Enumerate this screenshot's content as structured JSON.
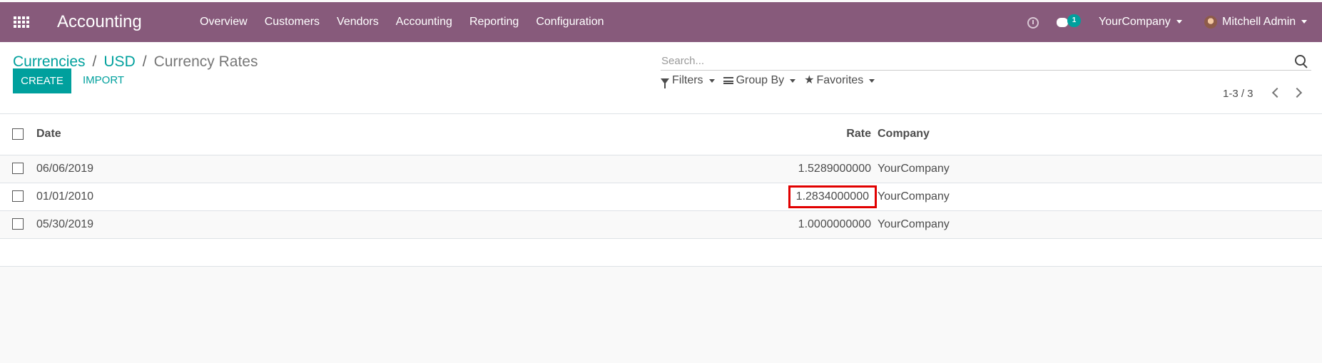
{
  "navbar": {
    "brand": "Accounting",
    "menu": [
      "Overview",
      "Customers",
      "Vendors",
      "Accounting",
      "Reporting",
      "Configuration"
    ],
    "messages_count": "1",
    "company": "YourCompany",
    "user": "Mitchell Admin"
  },
  "breadcrumb": {
    "first": "Currencies",
    "second": "USD",
    "current": "Currency Rates"
  },
  "search": {
    "placeholder": "Search..."
  },
  "toolbar": {
    "create_label": "CREATE",
    "import_label": "IMPORT",
    "filters_label": "Filters",
    "group_by_label": "Group By",
    "favorites_label": "Favorites",
    "pager": "1-3 / 3"
  },
  "table": {
    "headers": [
      "Date",
      "Rate",
      "Company"
    ],
    "rows": [
      {
        "date": "06/06/2019",
        "rate": "1.5289000000",
        "company": "YourCompany"
      },
      {
        "date": "01/01/2010",
        "rate": "1.2834000000",
        "company": "YourCompany"
      },
      {
        "date": "05/30/2019",
        "rate": "1.0000000000",
        "company": "YourCompany"
      }
    ]
  },
  "colors": {
    "navbar": "#875a7b",
    "primary": "#00a09d",
    "highlight": "#e10000"
  },
  "icons": [
    "apps-grid-icon",
    "clock-icon",
    "chat-icon",
    "search-icon",
    "filter-icon",
    "group-by-icon",
    "star-icon",
    "chevron-left-icon",
    "chevron-right-icon"
  ]
}
